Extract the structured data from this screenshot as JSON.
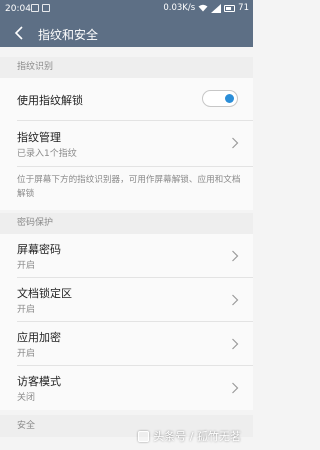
{
  "status_bar": {
    "time": "20:04",
    "speed": "0.03",
    "speed_unit": "K/s",
    "battery": "71"
  },
  "header": {
    "title": "指纹和安全"
  },
  "sections": {
    "fingerprint": "指纹识别",
    "password": "密码保护",
    "security": "安全"
  },
  "fingerprint": {
    "unlock_label": "使用指纹解锁",
    "unlock_enabled": true,
    "manage_label": "指纹管理",
    "manage_sub": "已录入1个指纹",
    "hint": "位于屏幕下方的指纹识别器，可用作屏幕解锁、应用和文档解锁"
  },
  "password": {
    "items": [
      {
        "label": "屏幕密码",
        "sub": "开启"
      },
      {
        "label": "文档锁定区",
        "sub": "开启"
      },
      {
        "label": "应用加密",
        "sub": "开启"
      },
      {
        "label": "访客模式",
        "sub": "关闭"
      }
    ]
  },
  "watermark": "头条号 / 孤竹无茗",
  "colors": {
    "appbar": "#5d6f85",
    "toggle_on": "#2b8ed8"
  }
}
